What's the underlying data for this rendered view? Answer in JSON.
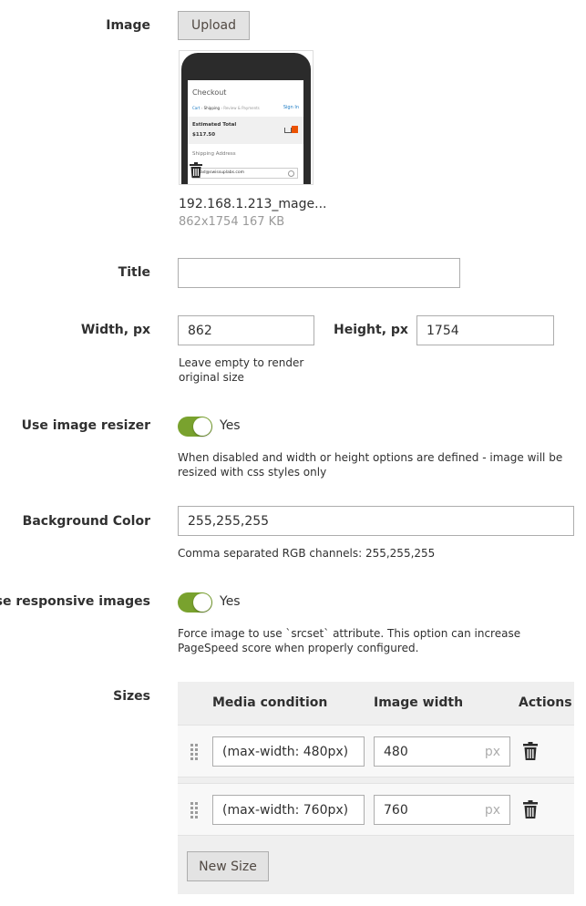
{
  "image": {
    "label": "Image",
    "upload_label": "Upload",
    "file_name": "192.168.1.213_mage...",
    "file_meta": "862x1754 167 KB",
    "preview": {
      "heading": "Checkout",
      "breadcrumb_cart": "Cart",
      "breadcrumb_shipping": "Shipping",
      "breadcrumb_review": "Review & Payments",
      "sign_in": "Sign In",
      "estimated_total_label": "Estimated Total",
      "estimated_total_value": "$117.50",
      "shipping_address": "Shipping Address",
      "email_value": "ad@swissuplabs.com"
    }
  },
  "title": {
    "label": "Title",
    "value": ""
  },
  "width": {
    "label": "Width, px",
    "value": "862"
  },
  "height": {
    "label": "Height, px",
    "value": "1754"
  },
  "dimensions_note": "Leave empty to render original size",
  "resizer": {
    "label": "Use image resizer",
    "state": "Yes",
    "note": "When disabled and width or height options are defined - image will be resized with css styles only"
  },
  "background_color": {
    "label": "Background Color",
    "value": "255,255,255",
    "note": "Comma separated RGB channels: 255,255,255"
  },
  "responsive": {
    "label": "Use responsive images",
    "state": "Yes",
    "note": "Force image to use `srcset` attribute. This option can increase PageSpeed score when properly configured."
  },
  "sizes": {
    "label": "Sizes",
    "col_media": "Media condition",
    "col_width": "Image width",
    "col_actions": "Actions",
    "unit": "px",
    "rows": [
      {
        "media": "(max-width: 480px)",
        "width": "480"
      },
      {
        "media": "(max-width: 760px)",
        "width": "760"
      }
    ],
    "new_size_label": "New Size"
  },
  "colors": {
    "toggle_on": "#79a22e",
    "link": "#1979c3",
    "accent": "#eb5202"
  }
}
